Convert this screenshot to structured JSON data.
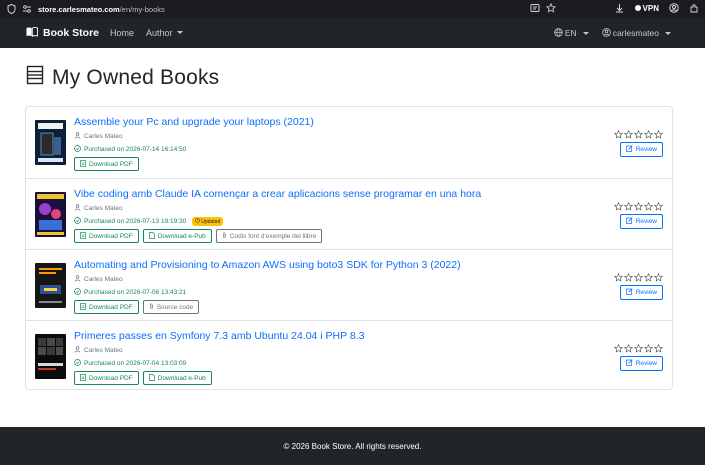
{
  "browser": {
    "url_host": "store.carlesmateo.com",
    "url_path": "/en/my-books",
    "vpn_label": "VPN"
  },
  "navbar": {
    "brand": "Book Store",
    "links": [
      "Home",
      "Author"
    ],
    "language": "EN",
    "user": "carlesmateo"
  },
  "page": {
    "title": "My Owned Books"
  },
  "books": [
    {
      "title": "Assemble your Pc and upgrade your laptops (2021)",
      "author": "Carles Mateo",
      "purchased": "Purchased on 2026-07-14 16:14:50",
      "updated": "",
      "buttons": [
        "Download PDF"
      ],
      "review": "Review"
    },
    {
      "title": "Vibe coding amb Claude IA començar a crear aplicacions sense programar en una hora",
      "author": "Carles Mateo",
      "purchased": "Purchased on 2026-07-13 19:19:30",
      "updated": "Updated",
      "buttons": [
        "Download PDF",
        "Download e-Pub",
        "Codis font d'exemple del llibre"
      ],
      "review": "Review"
    },
    {
      "title": "Automating and Provisioning to Amazon AWS using boto3 SDK for Python 3 (2022)",
      "author": "Carles Mateo",
      "purchased": "Purchased on 2026-07-06 13:43:21",
      "updated": "",
      "buttons": [
        "Download PDF",
        "Source code"
      ],
      "review": "Review"
    },
    {
      "title": "Primeres passes en Symfony 7.3 amb Ubuntu 24.04 i PHP 8.3",
      "author": "Carles Mateo",
      "purchased": "Purchased on 2026-07-04 13:03:09",
      "updated": "",
      "buttons": [
        "Download PDF",
        "Download e-Pub"
      ],
      "review": "Review"
    }
  ],
  "footer": {
    "text": "© 2026 Book Store. All rights reserved."
  },
  "colors": {
    "navbar": "#212529",
    "link": "#0d6efd",
    "success": "#198754",
    "badge": "#ffc107"
  }
}
